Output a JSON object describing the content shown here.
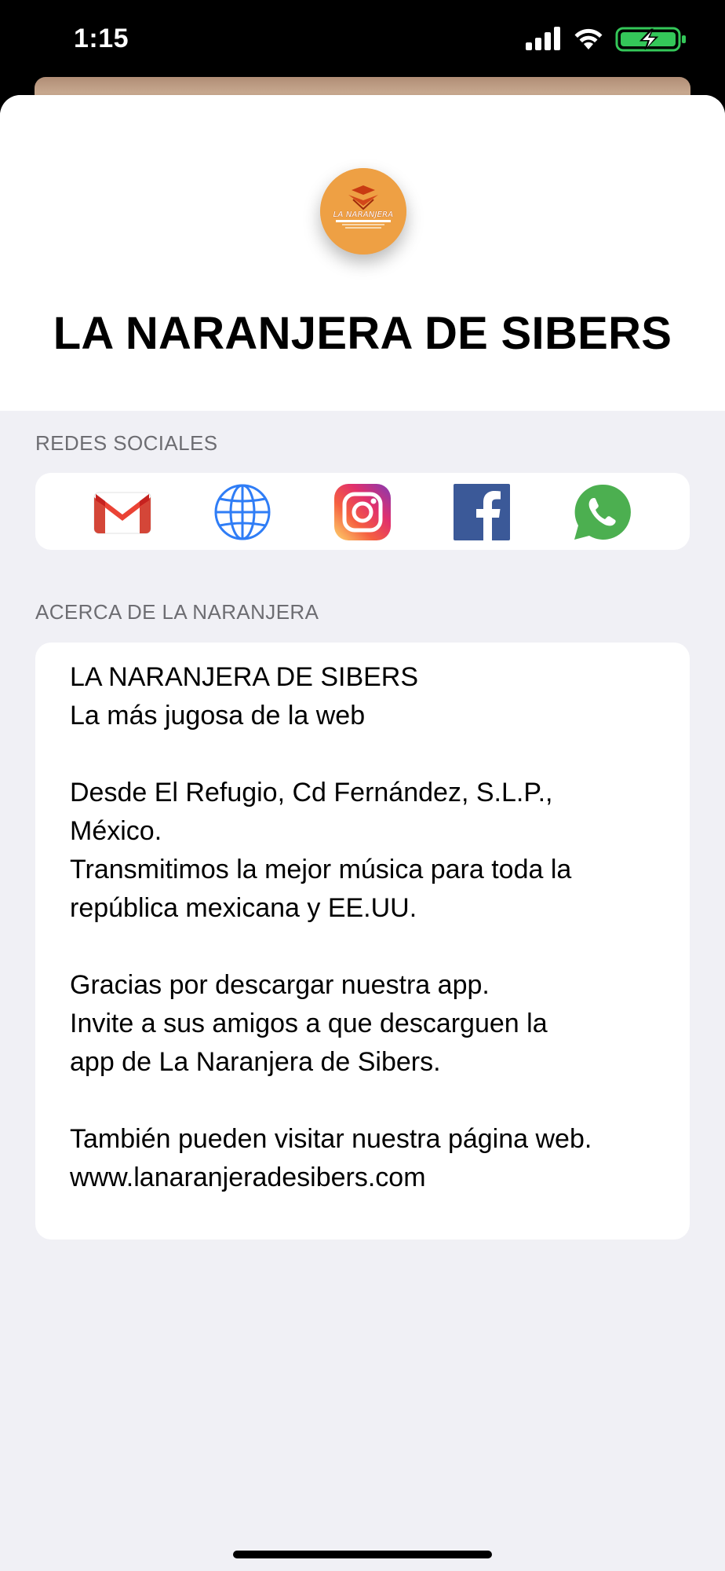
{
  "status_bar": {
    "time": "1:15",
    "icons": [
      "cellular-signal-icon",
      "wifi-icon",
      "battery-charging-icon"
    ],
    "battery_color": "#34c759"
  },
  "header": {
    "logo_text": "LA NARANJERA",
    "logo_icon": "la-naranjera-logo-icon",
    "logo_color": "#eea044",
    "title": "LA NARANJERA DE SIBERS"
  },
  "social": {
    "section_label": "REDES SOCIALES",
    "buttons": [
      {
        "name": "gmail",
        "icon": "gmail-icon"
      },
      {
        "name": "website",
        "icon": "globe-icon"
      },
      {
        "name": "instagram",
        "icon": "instagram-icon"
      },
      {
        "name": "facebook",
        "icon": "facebook-icon"
      },
      {
        "name": "whatsapp",
        "icon": "whatsapp-icon"
      }
    ]
  },
  "about": {
    "section_label": "ACERCA DE LA NARANJERA",
    "lines": [
      "LA NARANJERA DE SIBERS",
      "La más jugosa de la web",
      "",
      "Desde El Refugio, Cd Fernández, S.L.P.,",
      "México.",
      "Transmitimos la mejor música para toda la",
      "república mexicana y EE.UU.",
      "",
      "Gracias por descargar nuestra app.",
      "Invite a sus amigos a que descarguen la",
      "app de La Naranjera de Sibers.",
      "",
      "También pueden visitar nuestra página web.",
      "www.lanaranjeradesibers.com"
    ]
  },
  "colors": {
    "background_grouped": "#f0f0f5",
    "section_label": "#6d6d72",
    "gmail_red": "#ea4335",
    "globe_blue": "#2f7df6",
    "facebook_blue": "#3b5998",
    "whatsapp_green": "#4caf50"
  }
}
